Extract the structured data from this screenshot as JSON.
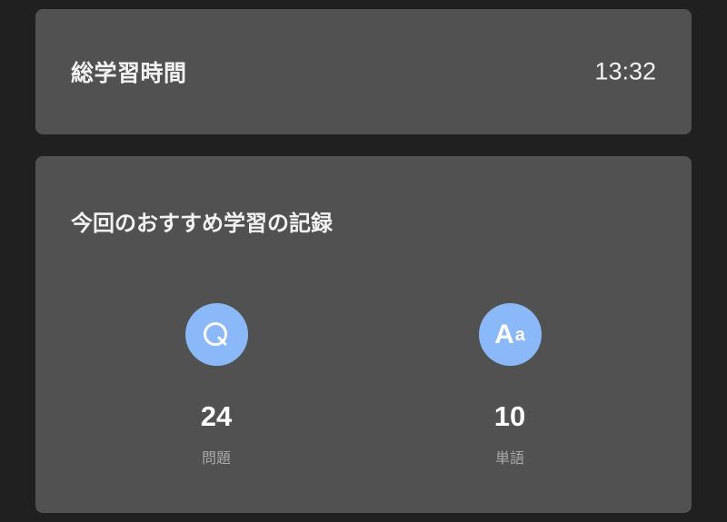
{
  "total_study": {
    "label": "総学習時間",
    "time": "13:32"
  },
  "recommended_record": {
    "title": "今回のおすすめ学習の記録",
    "stats": [
      {
        "icon": "question-icon",
        "icon_glyph": "Q",
        "value": "24",
        "label": "問題"
      },
      {
        "icon": "vocabulary-icon",
        "icon_glyph": "Aa",
        "value": "10",
        "label": "単語"
      }
    ]
  },
  "colors": {
    "background": "#202020",
    "card": "#515151",
    "icon_circle": "#8bb8f8",
    "text_primary": "#f2f2f2",
    "text_secondary": "#a8a8a8"
  }
}
